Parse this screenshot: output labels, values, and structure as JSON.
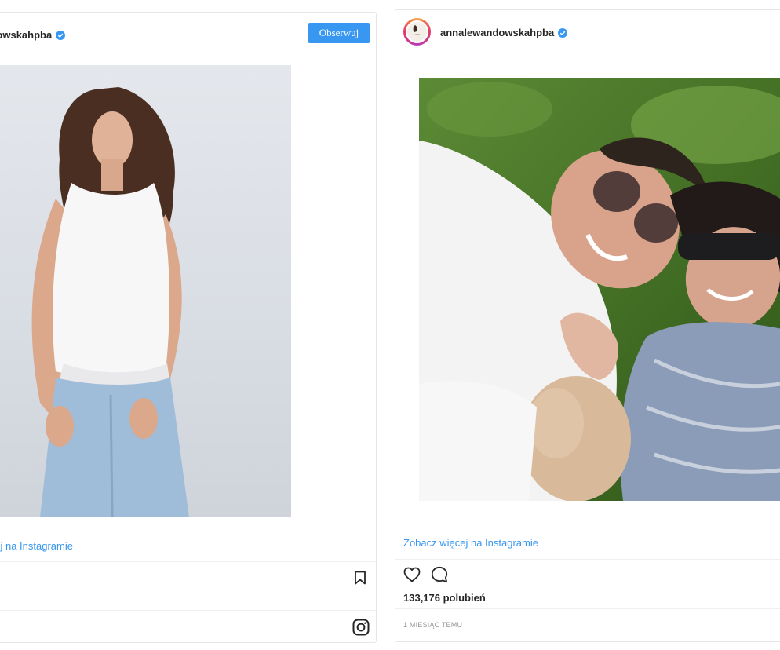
{
  "posts": [
    {
      "username": "annalewandowskahpba",
      "follow_label": "Obserwuj",
      "more_link": "Zobacz więcej na Instagramie"
    },
    {
      "username": "annalewandowskahpba",
      "more_link": "Zobacz więcej na Instagramie",
      "likes": "133,176 polubień",
      "time": "1 MIESIĄC TEMU"
    }
  ],
  "colors": {
    "accent": "#3897f0",
    "verified": "#3897f0",
    "border": "#e6e6e6"
  },
  "icons": [
    "verified-badge-icon",
    "bookmark-icon",
    "instagram-logo-icon",
    "heart-icon",
    "comment-icon"
  ]
}
